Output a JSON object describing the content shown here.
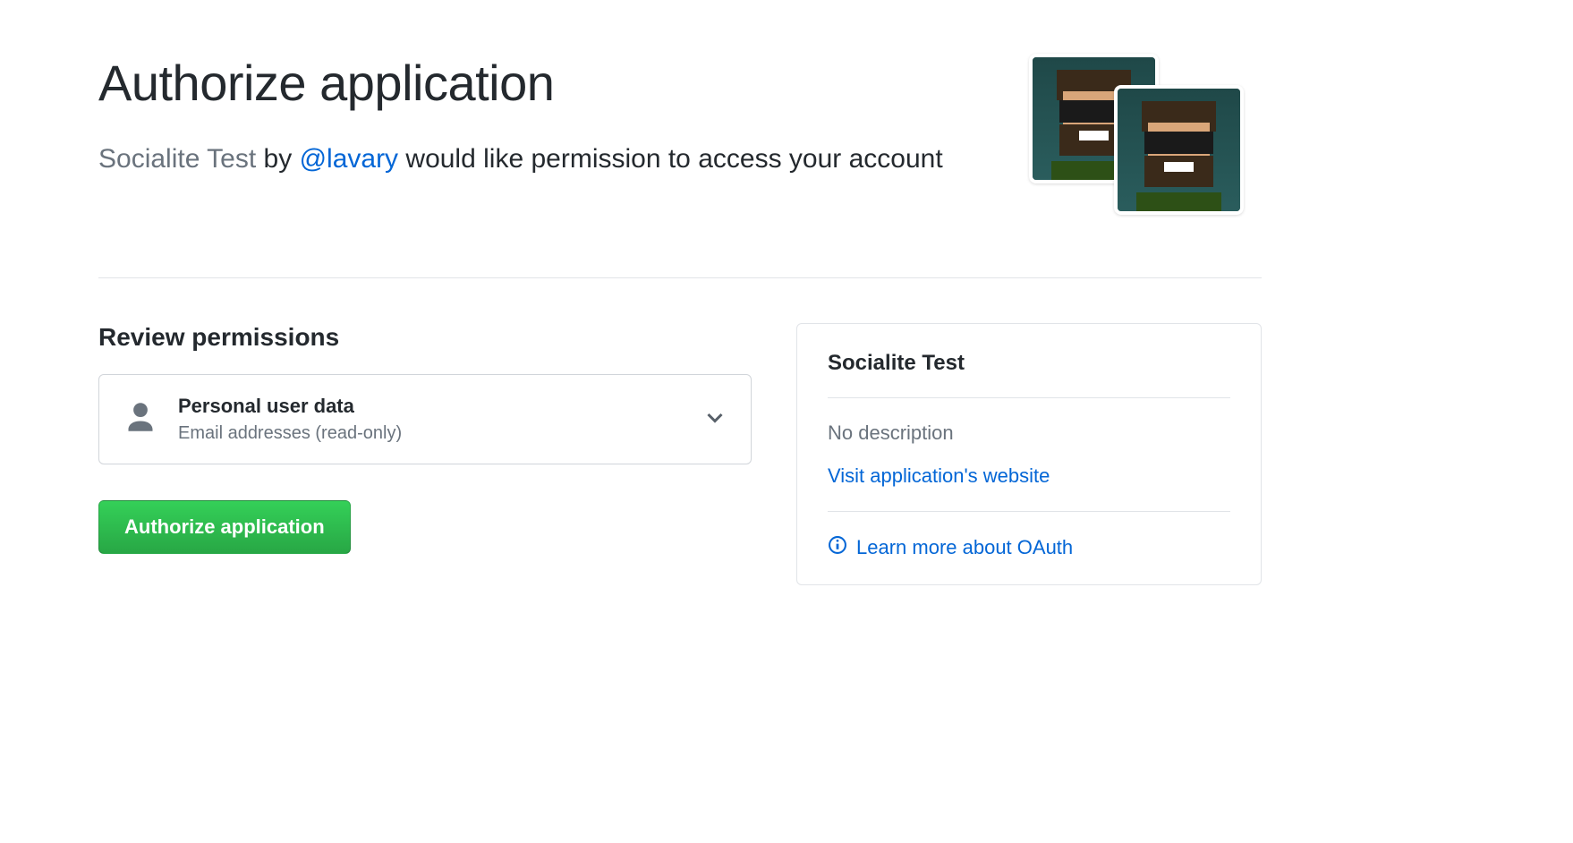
{
  "header": {
    "title": "Authorize application",
    "app_name": "Socialite Test",
    "by_text": " by ",
    "author": "@lavary",
    "rest": " would like permission to access your account"
  },
  "permissions": {
    "heading": "Review permissions",
    "item": {
      "title": "Personal user data",
      "subtitle": "Email addresses (read-only)"
    }
  },
  "actions": {
    "authorize_label": "Authorize application"
  },
  "sidebar": {
    "app_title": "Socialite Test",
    "description": "No description",
    "visit_link": "Visit application's website",
    "oauth_link": "Learn more about OAuth"
  },
  "icons": {
    "person": "person-icon",
    "chevron": "chevron-down-icon",
    "info": "info-icon"
  }
}
